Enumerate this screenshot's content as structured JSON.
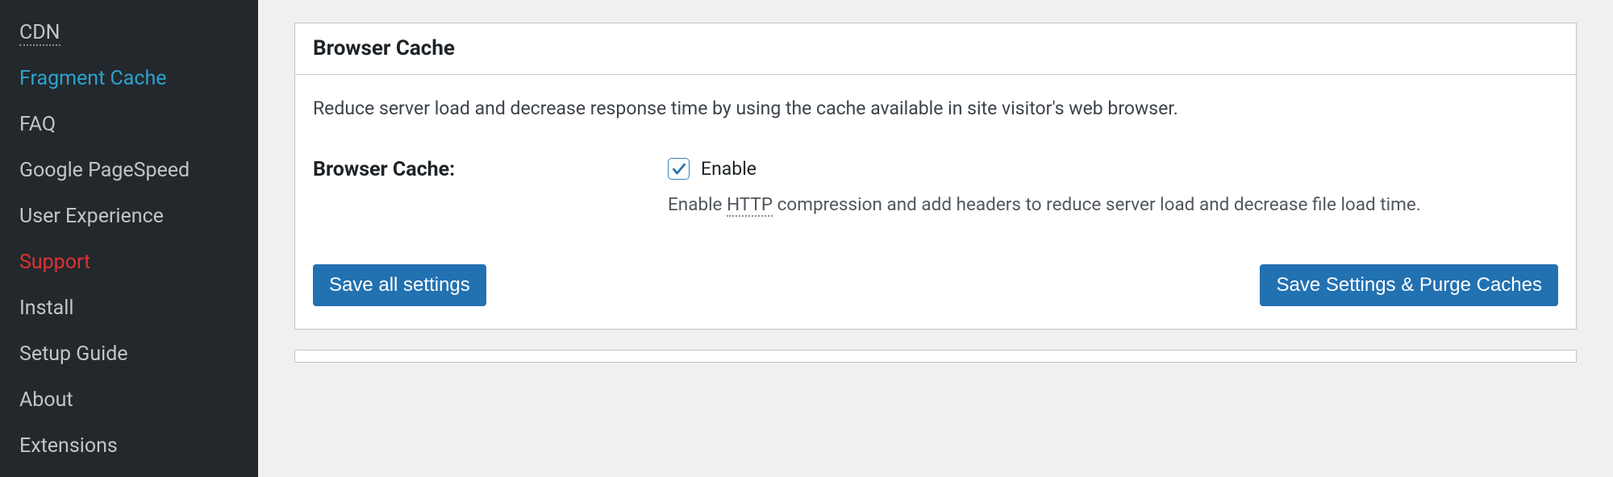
{
  "sidebar": {
    "items": [
      {
        "label": "CDN",
        "style": "dotted"
      },
      {
        "label": "Fragment Cache",
        "style": "active"
      },
      {
        "label": "FAQ"
      },
      {
        "label": "Google PageSpeed"
      },
      {
        "label": "User Experience"
      },
      {
        "label": "Support",
        "style": "support"
      },
      {
        "label": "Install"
      },
      {
        "label": "Setup Guide"
      },
      {
        "label": "About"
      },
      {
        "label": "Extensions"
      }
    ]
  },
  "panel": {
    "title": "Browser Cache",
    "description": "Reduce server load and decrease response time by using the cache available in site visitor's web browser.",
    "setting": {
      "label": "Browser Cache:",
      "checkbox_label": "Enable",
      "checked": true,
      "help_prefix": "Enable ",
      "help_http": "HTTP",
      "help_suffix": " compression and add headers to reduce server load and decrease file load time."
    },
    "buttons": {
      "save_all": "Save all settings",
      "save_purge": "Save Settings & Purge Caches"
    }
  }
}
